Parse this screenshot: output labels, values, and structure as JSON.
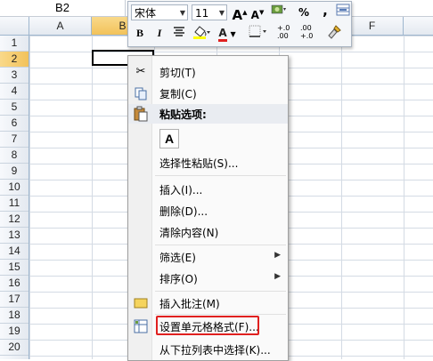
{
  "name_box": "B2",
  "columns": [
    "A",
    "B",
    "C",
    "D",
    "E",
    "F"
  ],
  "selected_column": "B",
  "rows": [
    "1",
    "2",
    "3",
    "4",
    "5",
    "6",
    "7",
    "8",
    "9",
    "10",
    "11",
    "12",
    "13",
    "14",
    "15",
    "16",
    "17",
    "18",
    "19",
    "20"
  ],
  "selected_row": "2",
  "mini_toolbar": {
    "font": "宋体",
    "size": "11",
    "grow_font": "A",
    "shrink_font": "A",
    "percent": "%",
    "comma": ",",
    "bold": "B",
    "italic": "I",
    "font_color_letter": "A",
    "inc_decimal": "+.0\n.00",
    "dec_decimal": ".00\n+.0"
  },
  "context_menu": {
    "cut": "剪切(T)",
    "copy": "复制(C)",
    "paste_options": "粘贴选项:",
    "paste_icon": "A",
    "paste_special": "选择性粘贴(S)...",
    "insert": "插入(I)...",
    "delete": "删除(D)...",
    "clear": "清除内容(N)",
    "filter": "筛选(E)",
    "sort": "排序(O)",
    "insert_comment": "插入批注(M)",
    "format_cells": "设置单元格格式(F)...",
    "pick_list": "从下拉列表中选择(K)..."
  },
  "colors": {
    "highlight": "#e0201f",
    "selection": "#f2c25a"
  }
}
